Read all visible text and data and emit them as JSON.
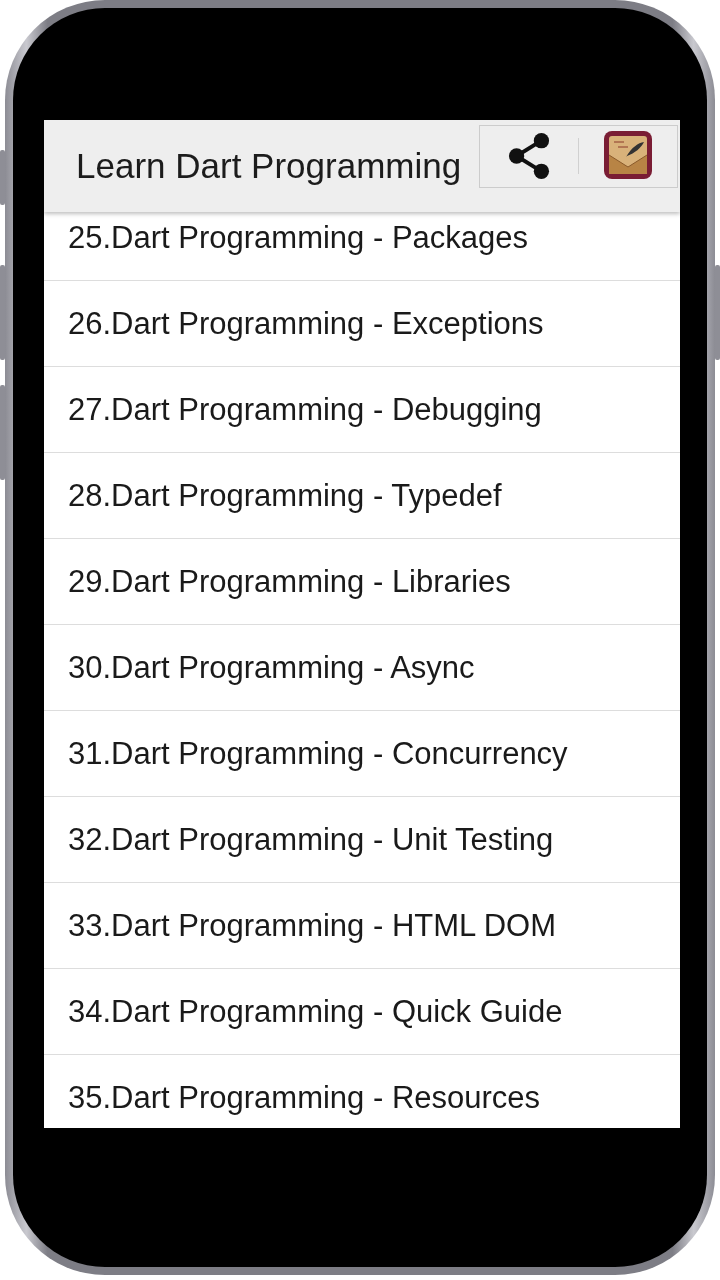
{
  "app_bar": {
    "title": "Learn Dart Programming"
  },
  "list": {
    "items": [
      {
        "label": "25.Dart Programming - Packages"
      },
      {
        "label": "26.Dart Programming - Exceptions"
      },
      {
        "label": "27.Dart Programming - Debugging"
      },
      {
        "label": "28.Dart Programming - Typedef"
      },
      {
        "label": "29.Dart Programming - Libraries"
      },
      {
        "label": "30.Dart Programming - Async"
      },
      {
        "label": "31.Dart Programming - Concurrency"
      },
      {
        "label": "32.Dart Programming - Unit Testing"
      },
      {
        "label": "33.Dart Programming - HTML DOM"
      },
      {
        "label": "34.Dart Programming - Quick Guide"
      },
      {
        "label": "35.Dart Programming - Resources"
      }
    ]
  }
}
